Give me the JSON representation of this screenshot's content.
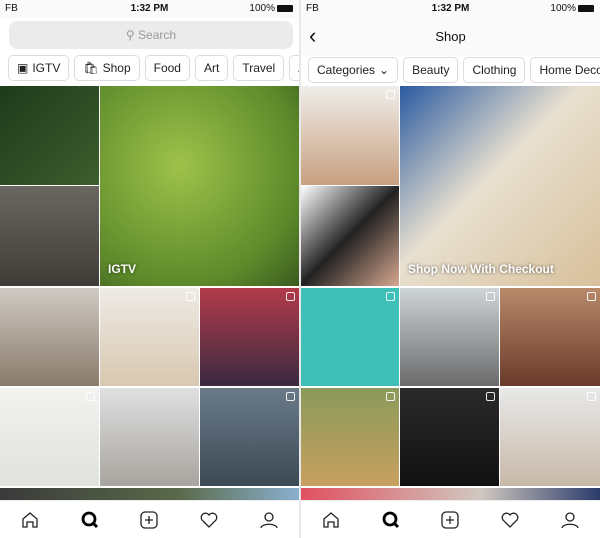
{
  "status": {
    "carrier": "FB",
    "time": "1:32 PM",
    "battery": "100%"
  },
  "explore": {
    "search_placeholder": "Search",
    "chips": [
      {
        "label": "IGTV",
        "icon": "igtv-icon"
      },
      {
        "label": "Shop",
        "icon": "shopping-bag-icon"
      },
      {
        "label": "Food"
      },
      {
        "label": "Art"
      },
      {
        "label": "Travel"
      },
      {
        "label": "Ar"
      }
    ],
    "igtv_label": "IGTV"
  },
  "shop": {
    "title": "Shop",
    "chips": [
      {
        "label": "Categories"
      },
      {
        "label": "Beauty"
      },
      {
        "label": "Clothing"
      },
      {
        "label": "Home Decor"
      }
    ],
    "feature_label": "Shop Now With Checkout"
  },
  "tabs": [
    "home-icon",
    "search-icon",
    "add-post-icon",
    "heart-icon",
    "profile-icon"
  ]
}
